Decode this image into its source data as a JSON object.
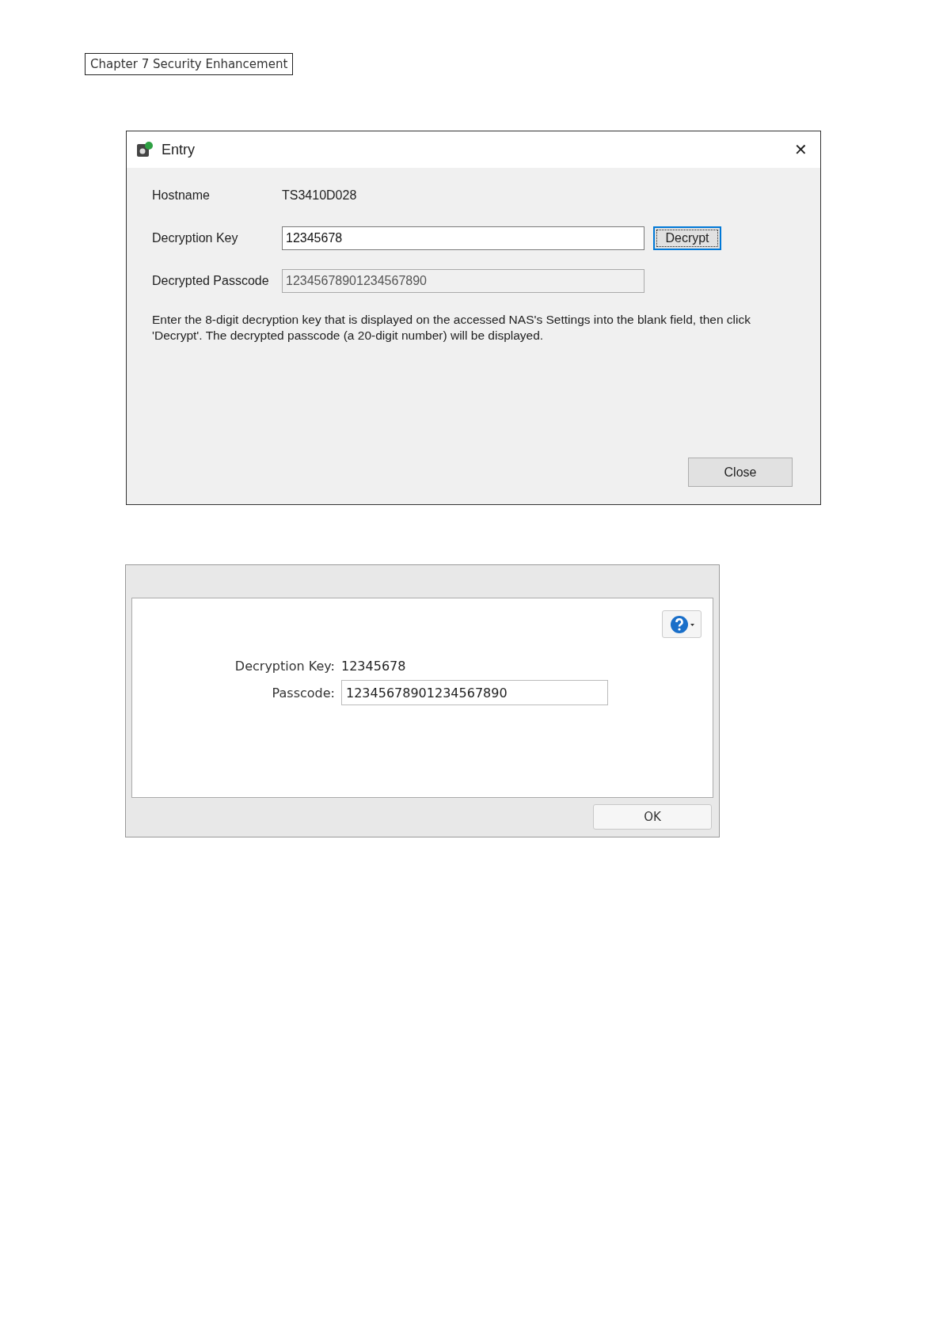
{
  "header": {
    "chapter": "Chapter 7 Security Enhancement"
  },
  "entry_dialog": {
    "title": "Entry",
    "close_glyph": "✕",
    "hostname": {
      "label": "Hostname",
      "value": "TS3410D028"
    },
    "decryption_key": {
      "label": "Decryption Key",
      "value": "12345678"
    },
    "decrypt_button": "Decrypt",
    "decrypted_passcode": {
      "label": "Decrypted Passcode",
      "value": "12345678901234567890"
    },
    "description": "Enter the 8-digit decryption key that is displayed on the accessed NAS's Settings into the blank field, then click 'Decrypt'. The decrypted passcode (a 20-digit number) will be displayed.",
    "close_button": "Close"
  },
  "nas_dialog": {
    "decryption_key": {
      "label": "Decryption Key:",
      "value": "12345678"
    },
    "passcode": {
      "label": "Passcode:",
      "value": "12345678901234567890"
    },
    "ok_button": "OK"
  }
}
